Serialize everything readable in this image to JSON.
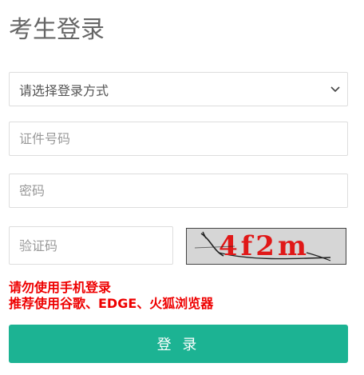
{
  "title": "考生登录",
  "login_method": {
    "selected": "请选择登录方式",
    "icon": "chevron-down-icon"
  },
  "id_field": {
    "placeholder": "证件号码"
  },
  "password_field": {
    "placeholder": "密码"
  },
  "captcha_field": {
    "placeholder": "验证码"
  },
  "captcha_image": {
    "text": "4f2m"
  },
  "warning": {
    "line1": "请勿使用手机登录",
    "line2": "推荐使用谷歌、EDGE、火狐浏览器",
    "color": "#ee0000"
  },
  "login_button": {
    "label": "登 录",
    "color": "#1cb393"
  }
}
